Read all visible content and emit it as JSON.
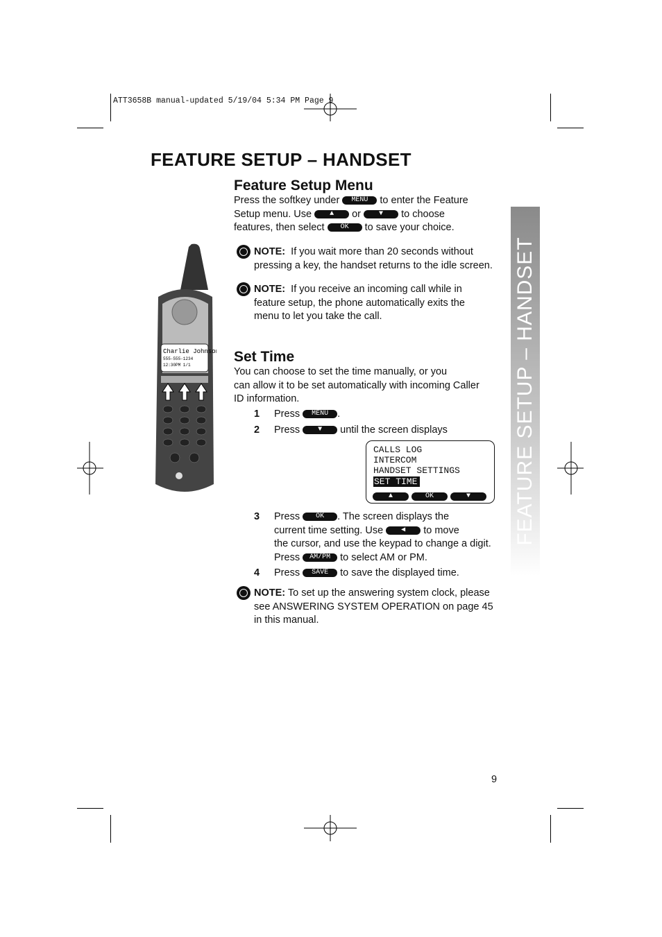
{
  "slug": "ATT3658B manual-updated  5/19/04  5:34 PM  Page 9",
  "title": "FEATURE SETUP – HANDSET",
  "side_tab": "FEATURE SETUP – HANDSET",
  "menu_section": {
    "heading": "Feature Setup Menu",
    "l1a": "Press the softkey under",
    "l1b": "to enter the Feature",
    "l2a": "Setup menu.  Use",
    "l2b": "or",
    "l2c": "to choose",
    "l3a": "features, then select",
    "l3b": "to save your choice."
  },
  "keys": {
    "menu": "MENU",
    "up": "▲",
    "down": "▼",
    "ok": "OK",
    "left": "◀",
    "ampm": "AM/PM",
    "save": "SAVE"
  },
  "notes": [
    {
      "label": "NOTE:",
      "lines": [
        "If you wait more than 20 seconds without",
        "pressing a key, the handset returns to the idle screen."
      ]
    },
    {
      "label": "NOTE:",
      "lines": [
        "If you receive an incoming call while in",
        "feature setup, the phone automatically exits the",
        "menu to let you take the call."
      ]
    },
    {
      "label": "NOTE:",
      "lines": [
        "To set up the answering system clock, please",
        "see ANSWERING SYSTEM OPERATION on page 45",
        "in this manual."
      ]
    }
  ],
  "set_time": {
    "heading": "Set Time",
    "intro": [
      "You can choose to set the time manually, or you",
      "can allow it to be set automatically with incoming Caller",
      "ID information."
    ],
    "steps": [
      {
        "n": "1",
        "a": "Press",
        "b": "."
      },
      {
        "n": "2",
        "a": "Press",
        "b": "until the screen displays"
      },
      {
        "n": "3",
        "a": "Press",
        "b": ". The screen displays the",
        "c": "current time setting.  Use",
        "d": "to move",
        "e": "the cursor, and use the keypad to change a digit.",
        "f": "Press",
        "g": "to select AM or PM."
      },
      {
        "n": "4",
        "a": "Press",
        "b": "to save the displayed time."
      }
    ]
  },
  "lcd": {
    "lines": [
      "CALLS LOG",
      "INTERCOM",
      "HANDSET SETTINGS"
    ],
    "selected": "SET TIME"
  },
  "phone_screen": [
    "Charlie Johnson",
    "555-555-1234",
    "12:30PM 1/1"
  ],
  "page_number": "9"
}
